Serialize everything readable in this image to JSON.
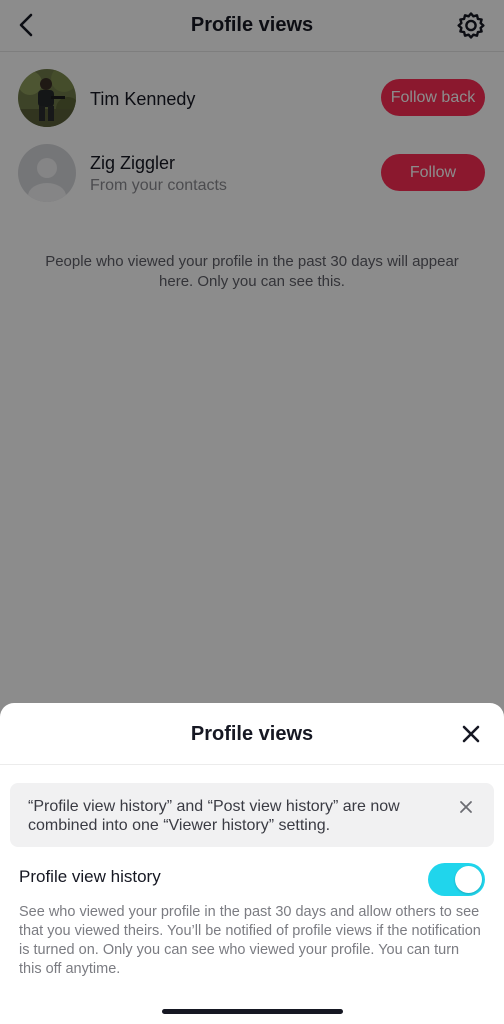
{
  "header": {
    "title": "Profile views"
  },
  "viewers": [
    {
      "name": "Tim Kennedy",
      "subtitle": "",
      "button": "Follow back"
    },
    {
      "name": "Zig Ziggler",
      "subtitle": "From your contacts",
      "button": "Follow"
    }
  ],
  "info_text": "People who viewed your profile in the past 30 days will appear here. Only you can see this.",
  "sheet": {
    "title": "Profile views",
    "notice": "“Profile view history” and “Post view history” are now combined into one “Viewer history” setting.",
    "toggle_label": "Profile view history",
    "toggle_on": true,
    "description": "See who viewed your profile in the past 30 days and allow others to see that you viewed theirs. You’ll be notified of profile views if the notification is turned on. Only you can see who viewed your profile. You can turn this off anytime."
  },
  "colors": {
    "follow_button": "#fe2c55",
    "toggle_on": "#20d5ec"
  }
}
